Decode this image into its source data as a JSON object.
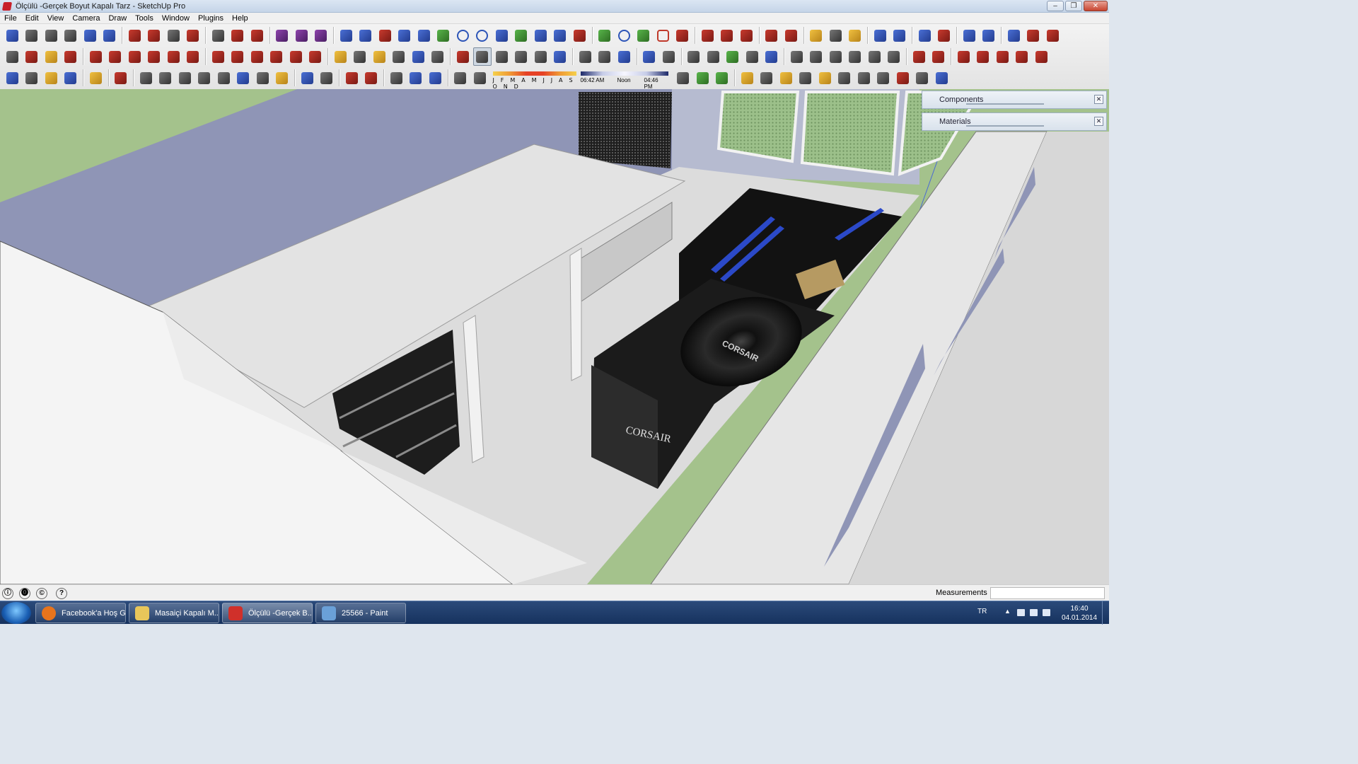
{
  "window": {
    "title": "Ölçülü -Gerçek Boyut Kapalı Tarz - SketchUp Pro",
    "controls": [
      "–",
      "❐",
      "✕"
    ]
  },
  "menu": [
    "File",
    "Edit",
    "View",
    "Camera",
    "Draw",
    "Tools",
    "Window",
    "Plugins",
    "Help"
  ],
  "toolbar": {
    "row1": [
      "c2",
      "c5",
      "c5",
      "c5",
      "c2",
      "c2",
      "|",
      "c1",
      "c1",
      "c5",
      "c1",
      "|",
      "c5",
      "c1",
      "c1",
      "|",
      "c8",
      "c8",
      "c8",
      "|",
      "c2",
      "c2",
      "c1",
      "c2",
      "c2",
      "c3",
      "c6",
      "c6",
      "c2",
      "c3",
      "c2",
      "c2",
      "c1",
      "|",
      "c3",
      "c6",
      "c3",
      "c7",
      "c1",
      "|",
      "c1",
      "c1",
      "c1",
      "|",
      "c1",
      "c1",
      "|",
      "c4",
      "c5",
      "c4",
      "|",
      "c2",
      "c2",
      "|",
      "c2",
      "c1",
      "|",
      "c2",
      "c2",
      "|",
      "c2",
      "c1",
      "c1"
    ],
    "row2": [
      "c5",
      "c1",
      "c4",
      "c1",
      "|",
      "c1",
      "c1",
      "c1",
      "c1",
      "c1",
      "c1",
      "|",
      "c1",
      "c1",
      "c1",
      "c1",
      "c1",
      "c1",
      "|",
      "c4",
      "c5",
      "c4",
      "c5",
      "c2",
      "c5",
      "|",
      "c1",
      "c5",
      "c5",
      "c5",
      "c5",
      "c2",
      "|",
      "c5",
      "c5",
      "c2",
      "|",
      "c2",
      "c5",
      "|",
      "c5",
      "c5",
      "c3",
      "c5",
      "c2",
      "|",
      "c5",
      "c5",
      "c5",
      "c5",
      "c5",
      "c5",
      "|",
      "c1",
      "c1",
      "|",
      "c1",
      "c1",
      "c1",
      "c1",
      "c1"
    ],
    "row3": [
      "c2",
      "c5",
      "c4",
      "c2",
      "|",
      "c4",
      "|",
      "c1",
      "|",
      "c5",
      "c5",
      "c5",
      "c5",
      "c5",
      "c2",
      "c5",
      "c4",
      "|",
      "c2",
      "c5",
      "|",
      "c1",
      "c1",
      "|",
      "c5",
      "c2",
      "c2",
      "|",
      "c5",
      "c5"
    ],
    "active_buttons": [
      "row2.23",
      "row3.25"
    ],
    "shadow": {
      "months": "J F M A M J J A S O N D",
      "time_start": "06:42 AM",
      "time_mid": "Noon",
      "time_end": "04:46 PM"
    },
    "row3_tail": [
      "c5",
      "c3",
      "c3",
      "|",
      "c4",
      "c5",
      "c4",
      "c5",
      "c4",
      "c5",
      "c5",
      "c5",
      "c1",
      "c5",
      "c2"
    ]
  },
  "tray": {
    "components": "Components",
    "materials": "Materials",
    "close": "✕"
  },
  "viewport": {
    "colors": {
      "ground": "#a4c28c",
      "case_white": "#e9e9e9",
      "case_side": "#d7d7d7",
      "lid": "#b7b9c7",
      "panel_blue": "#8f95b6",
      "mesh": "#2a2a2a",
      "mesh_green": "#9cc08a",
      "board": "#121212",
      "slot_blue": "#2b49c8",
      "psu": "#1b1b1b",
      "axis_green": "#3cb43c"
    },
    "labels": {
      "psu_brand": "CORSAIR",
      "fan_brand": "CORSAIR"
    }
  },
  "statusbar": {
    "icons": [
      "ⓘ",
      "⓿",
      "©",
      "?"
    ],
    "measurements_label": "Measurements",
    "measurements_value": ""
  },
  "taskbar": {
    "items": [
      {
        "label": "Facebook'a Hoş G...",
        "icon_color": "#e8741c"
      },
      {
        "label": "Masaiçi Kapalı M...",
        "icon_color": "#e8c65a"
      },
      {
        "label": "Ölçülü -Gerçek B...",
        "icon_color": "#d0302a",
        "active": true
      },
      {
        "label": "25566 - Paint",
        "icon_color": "#6aa0d8"
      }
    ],
    "lang": "TR",
    "time": "16:40",
    "date": "04.01.2014"
  }
}
